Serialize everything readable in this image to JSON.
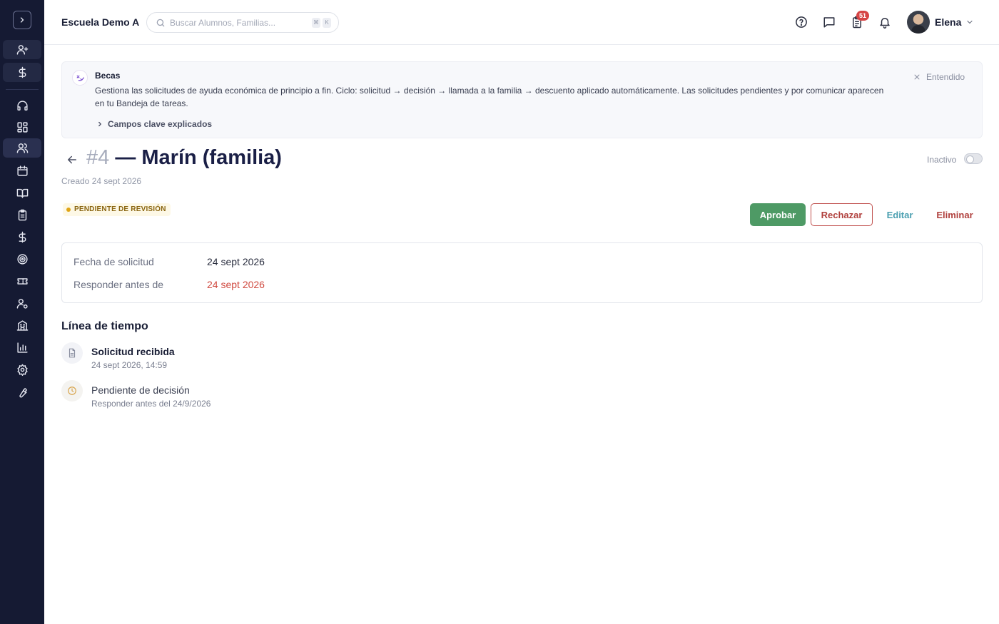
{
  "header": {
    "school_name": "Escuela Demo A",
    "search_placeholder": "Buscar Alumnos, Familias...",
    "shortcut_keys": [
      "⌘",
      "K"
    ],
    "tasks_badge": "51",
    "user_name": "Elena"
  },
  "sidebar": {
    "items": [
      {
        "icon": "user-plus-icon"
      },
      {
        "icon": "dollar-icon"
      },
      {
        "icon": "headset-icon"
      },
      {
        "icon": "grid-icon"
      },
      {
        "icon": "users-icon"
      },
      {
        "icon": "calendar-icon"
      },
      {
        "icon": "book-icon"
      },
      {
        "icon": "clipboard-icon"
      },
      {
        "icon": "dollar-icon"
      },
      {
        "icon": "target-icon"
      },
      {
        "icon": "ticket-icon"
      },
      {
        "icon": "user-gear-icon"
      },
      {
        "icon": "building-icon"
      },
      {
        "icon": "bar-chart-icon"
      },
      {
        "icon": "gear-icon"
      },
      {
        "icon": "wrench-icon"
      }
    ]
  },
  "banner": {
    "title": "Becas",
    "text": "Gestiona las solicitudes de ayuda económica de principio a fin. Ciclo: solicitud → decisión → llamada a la familia → descuento aplicado automáticamente. Las solicitudes pendientes y por comunicar aparecen en tu Bandeja de tareas.",
    "link": "Campos clave explicados",
    "dismiss": "Entendido"
  },
  "record": {
    "number": "#4",
    "title": " — Marín (familia)",
    "created": "Creado 24 sept 2026",
    "inactive_label": "Inactivo",
    "status": "PENDIENTE DE REVISIÓN"
  },
  "actions": {
    "approve": "Aprobar",
    "reject": "Rechazar",
    "edit": "Editar",
    "delete": "Eliminar"
  },
  "details": {
    "request_date_label": "Fecha de solicitud",
    "request_date_value": "24 sept 2026",
    "respond_by_label": "Responder antes de",
    "respond_by_value": "24 sept 2026"
  },
  "timeline": {
    "title": "Línea de tiempo",
    "events": [
      {
        "title": "Solicitud recibida",
        "subtitle": "24 sept 2026, 14:59"
      },
      {
        "title": "Pendiente de decisión",
        "subtitle": "Responder antes del 24/9/2026"
      }
    ]
  },
  "colors": {
    "sidebar_bg": "#151a33",
    "approve": "#4e9a65",
    "danger": "#b0403d",
    "edit": "#4a9fb0",
    "status_warning": "#e0a516"
  }
}
